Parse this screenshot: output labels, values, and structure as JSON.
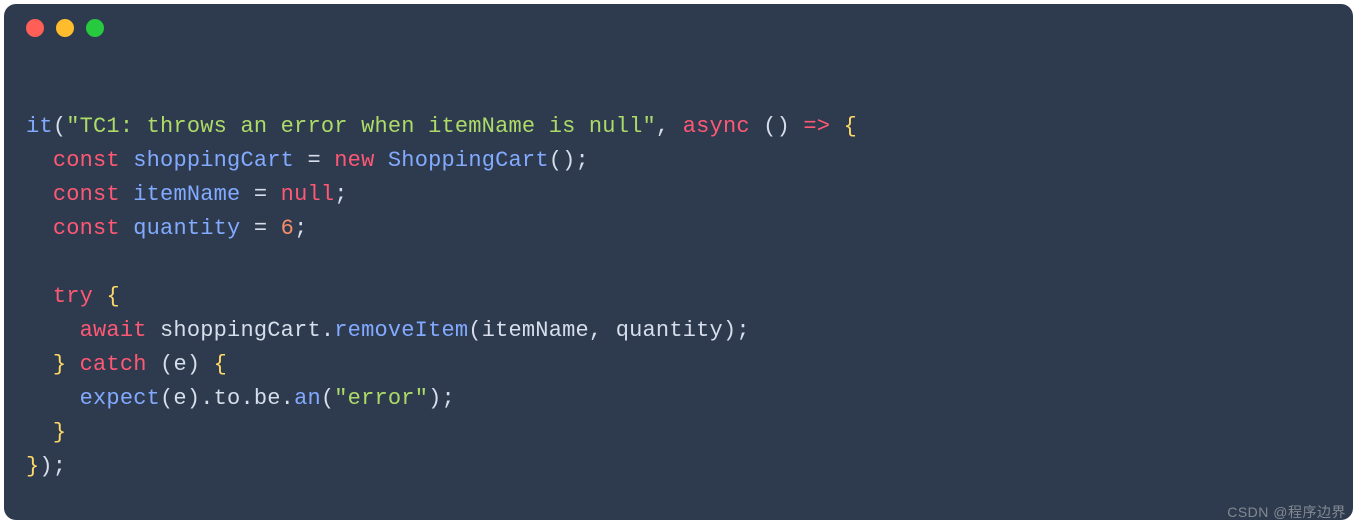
{
  "tokens": [
    {
      "t": "it",
      "c": "c-fn"
    },
    {
      "t": "(",
      "c": "c-punc"
    },
    {
      "t": "\"TC1: throws an error when itemName is null\"",
      "c": "c-str"
    },
    {
      "t": ", ",
      "c": "c-punc"
    },
    {
      "t": "async",
      "c": "c-kw"
    },
    {
      "t": " ",
      "c": "c-punc"
    },
    {
      "t": "(",
      "c": "c-punc"
    },
    {
      "t": ")",
      "c": "c-punc"
    },
    {
      "t": " ",
      "c": "c-punc"
    },
    {
      "t": "=>",
      "c": "c-arrow"
    },
    {
      "t": " ",
      "c": "c-punc"
    },
    {
      "t": "{",
      "c": "c-brace"
    },
    {
      "t": "\n  ",
      "c": "c-punc"
    },
    {
      "t": "const",
      "c": "c-kw"
    },
    {
      "t": " ",
      "c": "c-punc"
    },
    {
      "t": "shoppingCart",
      "c": "c-id"
    },
    {
      "t": " = ",
      "c": "c-punc"
    },
    {
      "t": "new",
      "c": "c-kw"
    },
    {
      "t": " ",
      "c": "c-punc"
    },
    {
      "t": "ShoppingCart",
      "c": "c-fn"
    },
    {
      "t": "();",
      "c": "c-punc"
    },
    {
      "t": "\n  ",
      "c": "c-punc"
    },
    {
      "t": "const",
      "c": "c-kw"
    },
    {
      "t": " ",
      "c": "c-punc"
    },
    {
      "t": "itemName",
      "c": "c-id"
    },
    {
      "t": " = ",
      "c": "c-punc"
    },
    {
      "t": "null",
      "c": "c-null"
    },
    {
      "t": ";",
      "c": "c-punc"
    },
    {
      "t": "\n  ",
      "c": "c-punc"
    },
    {
      "t": "const",
      "c": "c-kw"
    },
    {
      "t": " ",
      "c": "c-punc"
    },
    {
      "t": "quantity",
      "c": "c-id"
    },
    {
      "t": " = ",
      "c": "c-punc"
    },
    {
      "t": "6",
      "c": "c-num"
    },
    {
      "t": ";",
      "c": "c-punc"
    },
    {
      "t": "\n\n  ",
      "c": "c-punc"
    },
    {
      "t": "try",
      "c": "c-kw"
    },
    {
      "t": " ",
      "c": "c-punc"
    },
    {
      "t": "{",
      "c": "c-brace"
    },
    {
      "t": "\n    ",
      "c": "c-punc"
    },
    {
      "t": "await",
      "c": "c-kw"
    },
    {
      "t": " shoppingCart.",
      "c": "c-punc"
    },
    {
      "t": "removeItem",
      "c": "c-fn"
    },
    {
      "t": "(itemName, quantity);",
      "c": "c-punc"
    },
    {
      "t": "\n  ",
      "c": "c-punc"
    },
    {
      "t": "}",
      "c": "c-brace"
    },
    {
      "t": " ",
      "c": "c-punc"
    },
    {
      "t": "catch",
      "c": "c-kw"
    },
    {
      "t": " (e) ",
      "c": "c-punc"
    },
    {
      "t": "{",
      "c": "c-brace"
    },
    {
      "t": "\n    ",
      "c": "c-punc"
    },
    {
      "t": "expect",
      "c": "c-fn"
    },
    {
      "t": "(e).to.be.",
      "c": "c-punc"
    },
    {
      "t": "an",
      "c": "c-fn"
    },
    {
      "t": "(",
      "c": "c-punc"
    },
    {
      "t": "\"error\"",
      "c": "c-str"
    },
    {
      "t": ");",
      "c": "c-punc"
    },
    {
      "t": "\n  ",
      "c": "c-punc"
    },
    {
      "t": "}",
      "c": "c-brace"
    },
    {
      "t": "\n",
      "c": "c-punc"
    },
    {
      "t": "}",
      "c": "c-brace"
    },
    {
      "t": ");",
      "c": "c-punc"
    }
  ],
  "watermark": "CSDN @程序边界"
}
